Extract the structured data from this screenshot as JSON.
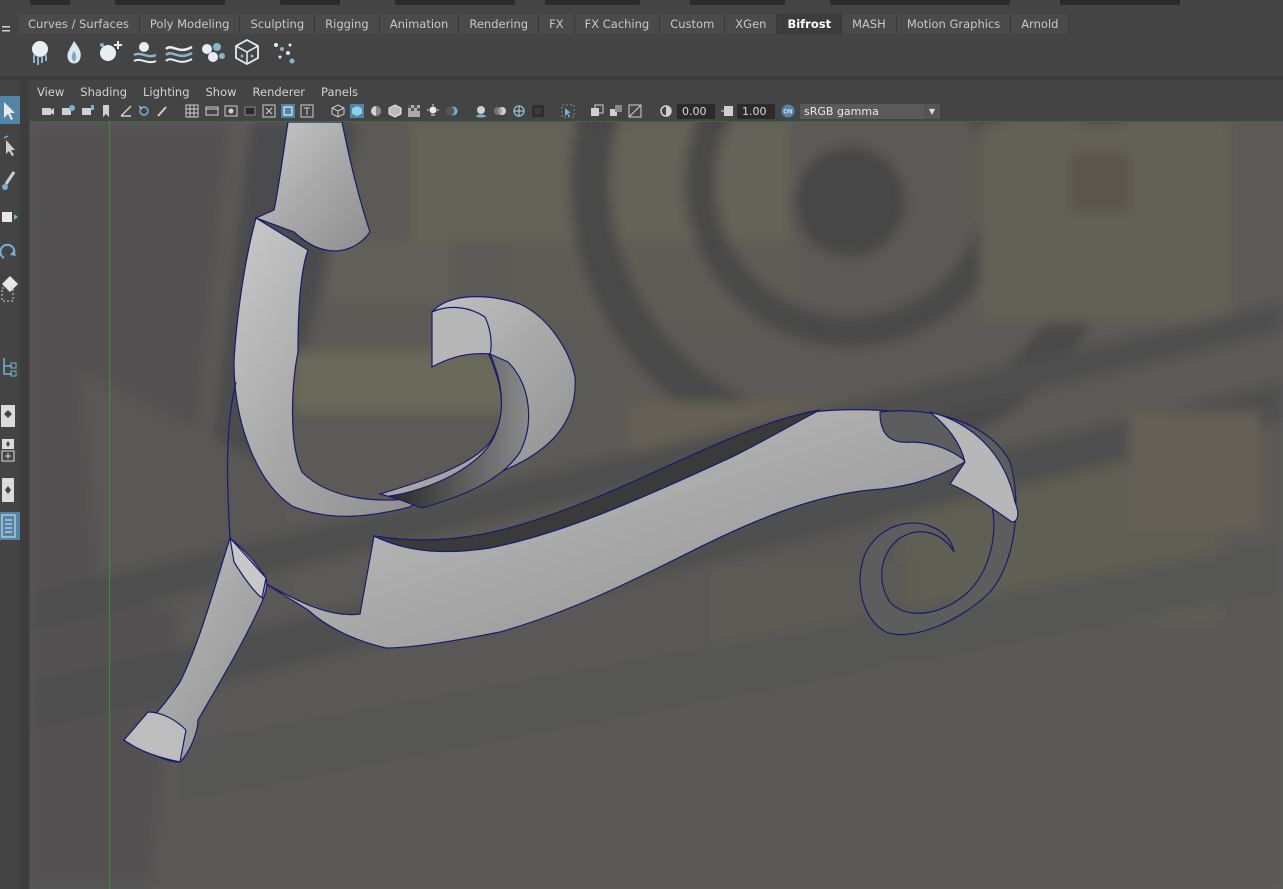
{
  "shelf": {
    "tabs": [
      {
        "label": "Curves / Surfaces",
        "active": false
      },
      {
        "label": "Poly Modeling",
        "active": false
      },
      {
        "label": "Sculpting",
        "active": false
      },
      {
        "label": "Rigging",
        "active": false
      },
      {
        "label": "Animation",
        "active": false
      },
      {
        "label": "Rendering",
        "active": false
      },
      {
        "label": "FX",
        "active": false
      },
      {
        "label": "FX Caching",
        "active": false
      },
      {
        "label": "Custom",
        "active": false
      },
      {
        "label": "XGen",
        "active": false
      },
      {
        "label": "Bifrost",
        "active": true
      },
      {
        "label": "MASH",
        "active": false
      },
      {
        "label": "Motion Graphics",
        "active": false
      },
      {
        "label": "Arnold",
        "active": false
      }
    ],
    "icons": [
      "liquid-icon",
      "aero-icon",
      "emitter-icon",
      "collider-icon",
      "accelerator-icon",
      "foam-icon",
      "cache-icon",
      "particles-icon"
    ]
  },
  "panel": {
    "menus": [
      "View",
      "Shading",
      "Lighting",
      "Show",
      "Renderer",
      "Panels"
    ],
    "exposure_value": "0.00",
    "gamma_value": "1.00",
    "color_space": "sRGB gamma"
  },
  "colors": {
    "accent": "#5285a6",
    "ui_bg": "#444444",
    "curve_outline": "#1a1a6e",
    "viewport_green": "#3c8a3c"
  }
}
